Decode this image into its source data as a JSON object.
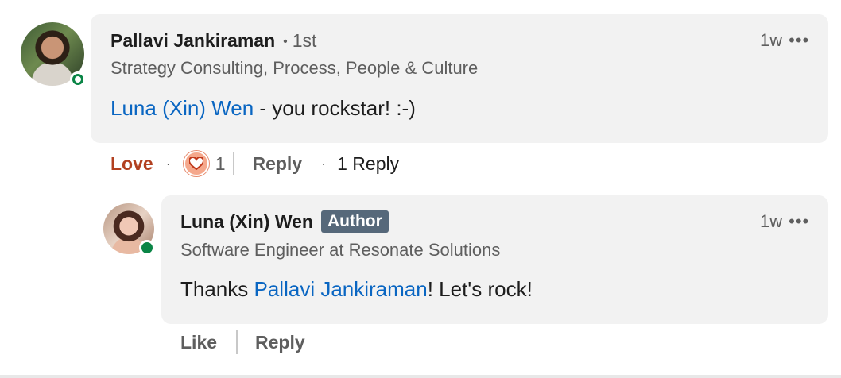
{
  "comment": {
    "author": "Pallavi Jankiraman",
    "degree": "1st",
    "headline": "Strategy Consulting, Process, People & Culture",
    "mention": "Luna (Xin) Wen",
    "text": " - you rockstar! :-)",
    "time": "1w",
    "more": "•••",
    "actions": {
      "reaction": "Love",
      "reaction_count": "1",
      "reply": "Reply",
      "replies": "1 Reply"
    }
  },
  "reply": {
    "author": "Luna (Xin) Wen",
    "badge": "Author",
    "headline": "Software Engineer at Resonate Solutions",
    "text_before": "Thanks ",
    "mention": "Pallavi Jankiraman",
    "text_after": "! Let's rock!",
    "time": "1w",
    "more": "•••",
    "actions": {
      "like": "Like",
      "reply": "Reply"
    }
  },
  "icons": {
    "reaction_icon": "heart-reaction-icon",
    "presence": "online-status-icon",
    "more": "more-options-icon"
  },
  "colors": {
    "link": "#0a66c2",
    "love": "#b24020",
    "online": "#0a8546",
    "badge": "#56687a",
    "bubble": "#f2f2f2"
  }
}
